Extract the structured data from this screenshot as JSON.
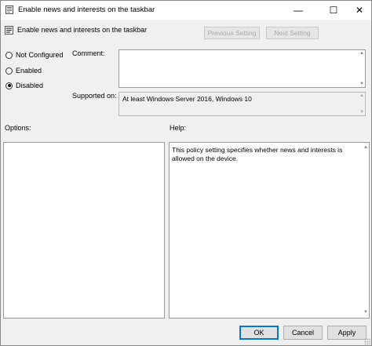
{
  "window": {
    "title": "Enable news and interests on the taskbar",
    "controls": {
      "minimize": "—",
      "maximize": "☐",
      "close": "✕"
    }
  },
  "header": {
    "title": "Enable news and interests on the taskbar",
    "icon": "policy-setting-icon",
    "prev_label": "Previous Setting",
    "next_label": "Next Setting"
  },
  "state": {
    "options": [
      {
        "label": "Not Configured",
        "checked": false
      },
      {
        "label": "Enabled",
        "checked": false
      },
      {
        "label": "Disabled",
        "checked": true
      }
    ]
  },
  "comment": {
    "label": "Comment:",
    "value": ""
  },
  "supported": {
    "label": "Supported on:",
    "value": "At least Windows Server 2016, Windows 10"
  },
  "options_panel": {
    "label": "Options:"
  },
  "help_panel": {
    "label": "Help:",
    "text": "This policy setting specifies whether news and interests is allowed on the device."
  },
  "buttons": {
    "ok": "OK",
    "cancel": "Cancel",
    "apply": "Apply"
  },
  "colors": {
    "window_bg": "#f0f0f0",
    "accent": "#0078d7",
    "disabled_text": "#a8a8a8"
  }
}
